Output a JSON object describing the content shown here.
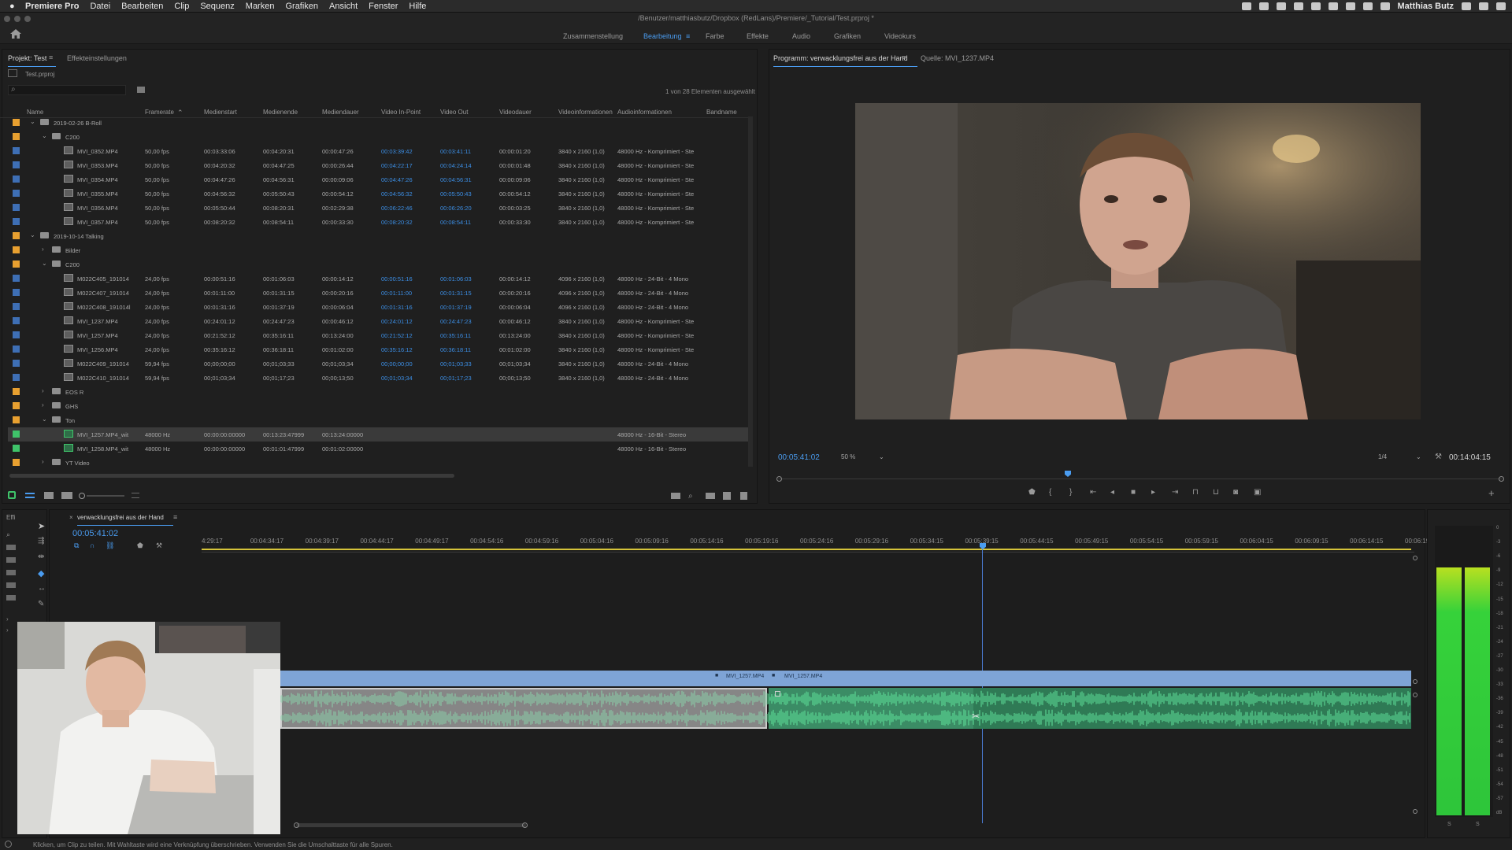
{
  "menubar": {
    "app": "Premiere Pro",
    "items": [
      "Datei",
      "Bearbeiten",
      "Clip",
      "Sequenz",
      "Marken",
      "Grafiken",
      "Ansicht",
      "Fenster",
      "Hilfe"
    ],
    "user": "Matthias Butz"
  },
  "window": {
    "path": "/Benutzer/matthiasbutz/Dropbox (RedLans)/Premiere/_Tutorial/Test.prproj *"
  },
  "workspaces": {
    "items": [
      "Zusammenstellung",
      "Bearbeitung",
      "Farbe",
      "Effekte",
      "Audio",
      "Grafiken",
      "Videokurs"
    ],
    "active": "Bearbeitung"
  },
  "project_panel": {
    "tab_project": "Projekt: Test",
    "tab_effects": "Effekteinstellungen",
    "file": "Test.prproj",
    "selection_info": "1 von 28 Elementen ausgewählt",
    "columns": [
      "Name",
      "Framerate",
      "Medienstart",
      "Medienende",
      "Mediendauer",
      "Video In-Point",
      "Video Out",
      "Videodauer",
      "Videoinformationen",
      "Audioinformationen",
      "Bandname"
    ],
    "rows": [
      {
        "level": 0,
        "type": "folder",
        "twirl": "open",
        "label_color": "#e8a030",
        "name": "2019-02-26 B-Roll"
      },
      {
        "level": 1,
        "type": "folder",
        "twirl": "open",
        "label_color": "#e8a030",
        "name": "C200"
      },
      {
        "level": 2,
        "type": "clip",
        "label_color": "#3e6fb5",
        "name": "MVI_0352.MP4",
        "fps": "50,00 fps",
        "start": "00:03:33:06",
        "end": "00:04:20:31",
        "dur": "00:00:47:26",
        "in": "00:03:39:42",
        "out": "00:03:41:11",
        "vdur": "00:00:01:20",
        "vinfo": "3840 x 2160 (1,0)",
        "ainfo": "48000 Hz - Komprimiert - Ste"
      },
      {
        "level": 2,
        "type": "clip",
        "label_color": "#3e6fb5",
        "name": "MVI_0353.MP4",
        "fps": "50,00 fps",
        "start": "00:04:20:32",
        "end": "00:04:47:25",
        "dur": "00:00:26:44",
        "in": "00:04:22:17",
        "out": "00:04:24:14",
        "vdur": "00:00:01:48",
        "vinfo": "3840 x 2160 (1,0)",
        "ainfo": "48000 Hz - Komprimiert - Ste"
      },
      {
        "level": 2,
        "type": "clip",
        "label_color": "#3e6fb5",
        "name": "MVI_0354.MP4",
        "fps": "50,00 fps",
        "start": "00:04:47:26",
        "end": "00:04:56:31",
        "dur": "00:00:09:06",
        "in": "00:04:47:26",
        "out": "00:04:56:31",
        "vdur": "00:00:09:06",
        "vinfo": "3840 x 2160 (1,0)",
        "ainfo": "48000 Hz - Komprimiert - Ste"
      },
      {
        "level": 2,
        "type": "clip",
        "label_color": "#3e6fb5",
        "name": "MVI_0355.MP4",
        "fps": "50,00 fps",
        "start": "00:04:56:32",
        "end": "00:05:50:43",
        "dur": "00:00:54:12",
        "in": "00:04:56:32",
        "out": "00:05:50:43",
        "vdur": "00:00:54:12",
        "vinfo": "3840 x 2160 (1,0)",
        "ainfo": "48000 Hz - Komprimiert - Ste"
      },
      {
        "level": 2,
        "type": "clip",
        "label_color": "#3e6fb5",
        "name": "MVI_0356.MP4",
        "fps": "50,00 fps",
        "start": "00:05:50:44",
        "end": "00:08:20:31",
        "dur": "00:02:29:38",
        "in": "00:06:22:46",
        "out": "00:06:26:20",
        "vdur": "00:00:03:25",
        "vinfo": "3840 x 2160 (1,0)",
        "ainfo": "48000 Hz - Komprimiert - Ste"
      },
      {
        "level": 2,
        "type": "clip",
        "label_color": "#3e6fb5",
        "name": "MVI_0357.MP4",
        "fps": "50,00 fps",
        "start": "00:08:20:32",
        "end": "00:08:54:11",
        "dur": "00:00:33:30",
        "in": "00:08:20:32",
        "out": "00:08:54:11",
        "vdur": "00:00:33:30",
        "vinfo": "3840 x 2160 (1,0)",
        "ainfo": "48000 Hz - Komprimiert - Ste"
      },
      {
        "level": 0,
        "type": "folder",
        "twirl": "open",
        "label_color": "#e8a030",
        "name": "2019-10-14 Talking"
      },
      {
        "level": 1,
        "type": "folder",
        "twirl": "closed",
        "label_color": "#e8a030",
        "name": "Bilder"
      },
      {
        "level": 1,
        "type": "folder",
        "twirl": "open",
        "label_color": "#e8a030",
        "name": "C200"
      },
      {
        "level": 2,
        "type": "clip",
        "label_color": "#3e6fb5",
        "name": "M022C405_191014",
        "fps": "24,00 fps",
        "start": "00:00:51:16",
        "end": "00:01:06:03",
        "dur": "00:00:14:12",
        "in": "00:00:51:16",
        "out": "00:01:06:03",
        "vdur": "00:00:14:12",
        "vinfo": "4096 x 2160 (1,0)",
        "ainfo": "48000 Hz - 24-Bit - 4 Mono"
      },
      {
        "level": 2,
        "type": "clip",
        "label_color": "#3e6fb5",
        "name": "M022C407_191014",
        "fps": "24,00 fps",
        "start": "00:01:11:00",
        "end": "00:01:31:15",
        "dur": "00:00:20:16",
        "in": "00:01:11:00",
        "out": "00:01:31:15",
        "vdur": "00:00:20:16",
        "vinfo": "4096 x 2160 (1,0)",
        "ainfo": "48000 Hz - 24-Bit - 4 Mono"
      },
      {
        "level": 2,
        "type": "clip",
        "label_color": "#3e6fb5",
        "name": "M022C408_191014l",
        "fps": "24,00 fps",
        "start": "00:01:31:16",
        "end": "00:01:37:19",
        "dur": "00:00:06:04",
        "in": "00:01:31:16",
        "out": "00:01:37:19",
        "vdur": "00:00:06:04",
        "vinfo": "4096 x 2160 (1,0)",
        "ainfo": "48000 Hz - 24-Bit - 4 Mono"
      },
      {
        "level": 2,
        "type": "clip",
        "label_color": "#3e6fb5",
        "name": "MVI_1237.MP4",
        "fps": "24,00 fps",
        "start": "00:24:01:12",
        "end": "00:24:47:23",
        "dur": "00:00:46:12",
        "in": "00:24:01:12",
        "out": "00:24:47:23",
        "vdur": "00:00:46:12",
        "vinfo": "3840 x 2160 (1,0)",
        "ainfo": "48000 Hz - Komprimiert - Ste"
      },
      {
        "level": 2,
        "type": "clip",
        "label_color": "#3e6fb5",
        "name": "MVI_1257.MP4",
        "fps": "24,00 fps",
        "start": "00:21:52:12",
        "end": "00:35:16:11",
        "dur": "00:13:24:00",
        "in": "00:21:52:12",
        "out": "00:35:16:11",
        "vdur": "00:13:24:00",
        "vinfo": "3840 x 2160 (1,0)",
        "ainfo": "48000 Hz - Komprimiert - Ste"
      },
      {
        "level": 2,
        "type": "clip",
        "label_color": "#3e6fb5",
        "name": "MVI_1256.MP4",
        "fps": "24,00 fps",
        "start": "00:35:16:12",
        "end": "00:36:18:11",
        "dur": "00:01:02:00",
        "in": "00:35:16:12",
        "out": "00:36:18:11",
        "vdur": "00:01:02:00",
        "vinfo": "3840 x 2160 (1,0)",
        "ainfo": "48000 Hz - Komprimiert - Ste"
      },
      {
        "level": 2,
        "type": "clip",
        "label_color": "#3e6fb5",
        "name": "M022C409_191014",
        "fps": "59,94 fps",
        "start": "00;00;00;00",
        "end": "00;01;03;33",
        "dur": "00;01;03;34",
        "in": "00;00;00;00",
        "out": "00;01;03;33",
        "vdur": "00;01;03;34",
        "vinfo": "3840 x 2160 (1,0)",
        "ainfo": "48000 Hz - 24-Bit - 4 Mono"
      },
      {
        "level": 2,
        "type": "clip",
        "label_color": "#3e6fb5",
        "name": "M022C410_191014",
        "fps": "59,94 fps",
        "start": "00;01;03;34",
        "end": "00;01;17;23",
        "dur": "00;00;13;50",
        "in": "00;01;03;34",
        "out": "00;01;17;23",
        "vdur": "00;00;13;50",
        "vinfo": "3840 x 2160 (1,0)",
        "ainfo": "48000 Hz - 24-Bit - 4 Mono"
      },
      {
        "level": 1,
        "type": "folder",
        "twirl": "closed",
        "label_color": "#e8a030",
        "name": "EOS R"
      },
      {
        "level": 1,
        "type": "folder",
        "twirl": "closed",
        "label_color": "#e8a030",
        "name": "GHS"
      },
      {
        "level": 1,
        "type": "folder",
        "twirl": "open",
        "label_color": "#e8a030",
        "name": "Ton"
      },
      {
        "level": 2,
        "type": "audio",
        "label_color": "#3fc46a",
        "selected": true,
        "name": "MVI_1257.MP4_wit",
        "fps": "48000 Hz",
        "start": "00:00:00:00000",
        "end": "00:13:23:47999",
        "dur": "00:13:24:00000",
        "ainfo": "48000 Hz - 16-Bit - Stereo"
      },
      {
        "level": 2,
        "type": "audio",
        "label_color": "#3fc46a",
        "name": "MVI_1258.MP4_wit",
        "fps": "48000 Hz",
        "start": "00:00:00:00000",
        "end": "00:01:01:47999",
        "dur": "00:01:02:00000",
        "ainfo": "48000 Hz - 16-Bit - Stereo"
      },
      {
        "level": 1,
        "type": "folder",
        "twirl": "closed",
        "label_color": "#e8a030",
        "name": "YT Video"
      }
    ]
  },
  "monitor": {
    "tab_program": "Programm: verwacklungsfrei aus der Hand",
    "tab_source": "Quelle: MVI_1237.MP4",
    "timecode": "00:05:41:02",
    "zoom": "50 %",
    "resolution": "1/4",
    "duration": "00:14:04:15",
    "playhead_fraction": 0.4
  },
  "timeline": {
    "panel_tab": "Effi",
    "sequence_tab": "verwacklungsfrei aus der Hand",
    "timecode": "00:05:41:02",
    "ruler": [
      "4:29:17",
      "00:04:34:17",
      "00:04:39:17",
      "00:04:44:17",
      "00:04:49:17",
      "00:04:54:16",
      "00:04:59:16",
      "00:05:04:16",
      "00:05:09:16",
      "00:05:14:16",
      "00:05:19:16",
      "00:05:24:16",
      "00:05:29:16",
      "00:05:34:15",
      "00:05:39:15",
      "00:05:44:15",
      "00:05:49:15",
      "00:05:54:15",
      "00:05:59:15",
      "00:06:04:15",
      "00:06:09:15",
      "00:06:14:15",
      "00:06:19"
    ],
    "clip_a_label": "MVI_1257.MP4",
    "clip_b_label": "MVI_1257.MP4",
    "meter_scale": [
      "0",
      "-3",
      "-6",
      "-9",
      "-12",
      "-15",
      "-18",
      "-21",
      "-24",
      "-27",
      "-30",
      "-33",
      "-36",
      "-39",
      "-42",
      "-45",
      "-48",
      "-51",
      "-54",
      "-57",
      "dB"
    ],
    "meter_solo": [
      "S",
      "S"
    ]
  },
  "status": {
    "text": "Klicken, um Clip zu teilen. Mit Wahltaste wird eine Verknüpfung überschrieben. Verwenden Sie die Umschalttaste für alle Spuren."
  },
  "colors": {
    "accent": "#4a9cf0",
    "folder_label": "#e8a030",
    "video_label": "#3e6fb5",
    "audio_label": "#3fc46a",
    "audio_clip": "#2f9e68",
    "waveform": "#49d98a"
  }
}
